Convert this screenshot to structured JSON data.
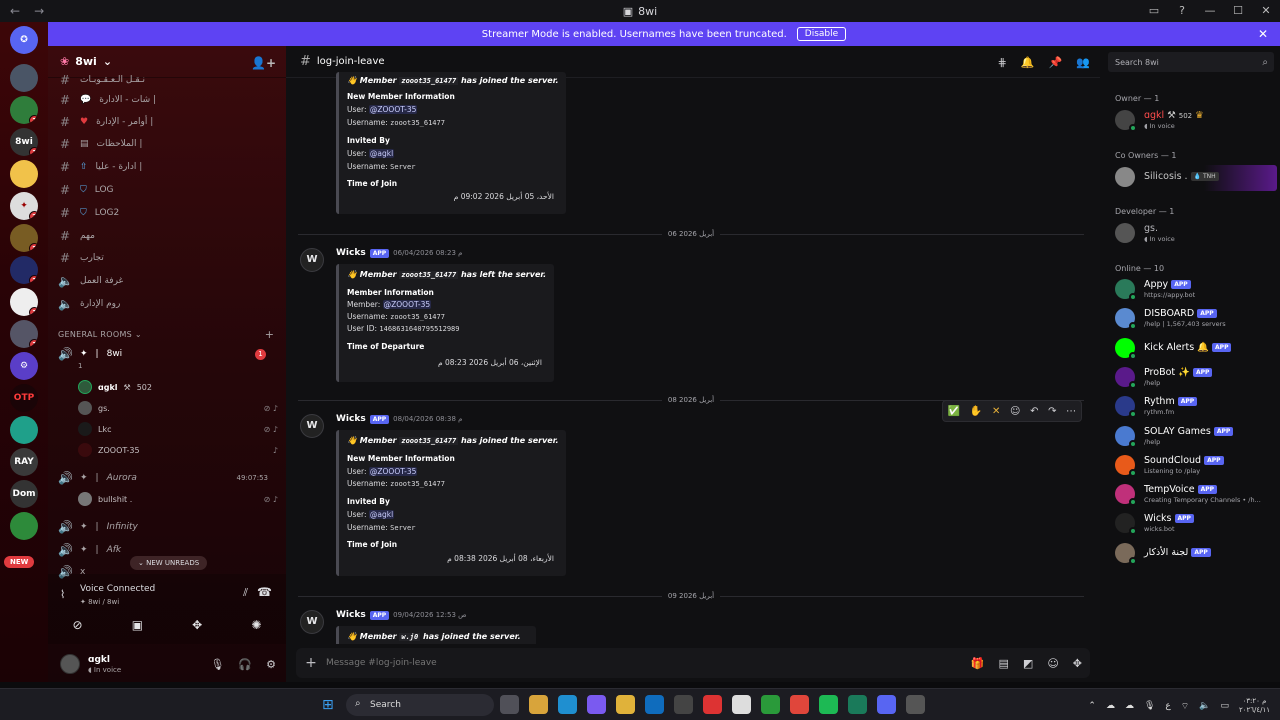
{
  "window": {
    "title": "8wi"
  },
  "banner": {
    "text": "Streamer Mode is enabled. Usernames have been truncated.",
    "button": "Disable"
  },
  "server": {
    "name": "8wi"
  },
  "channels": [
    {
      "name": "نـقـل الـعـقـوبـات",
      "icon": "#"
    },
    {
      "name": "شات - الادارة |",
      "icon": "#"
    },
    {
      "name": "أوامر - الإدارة |",
      "icon": "#"
    },
    {
      "name": "الملاحظات |",
      "icon": "#"
    },
    {
      "name": "ادارة - عليا |",
      "icon": "#"
    },
    {
      "name": "LOG",
      "icon": "#"
    },
    {
      "name": "LOG2",
      "icon": "#"
    },
    {
      "name": "مهم",
      "icon": "#"
    },
    {
      "name": "تجارب",
      "icon": "#"
    },
    {
      "name": "غرفة العمل",
      "icon": "speaker"
    },
    {
      "name": "روم الإدارة",
      "icon": "speaker"
    }
  ],
  "category": {
    "label": "GENERAL ROOMS"
  },
  "voice": {
    "room1": {
      "name": "8wi",
      "badge": "1",
      "sub": "1"
    },
    "users": [
      {
        "name": "ɑgkl",
        "tag": "502"
      },
      {
        "name": "gs."
      },
      {
        "name": "Lkc"
      },
      {
        "name": "ZOOOT-35"
      }
    ],
    "room2": {
      "name": "Aurora",
      "time": "49:07:53"
    },
    "room2_users": [
      {
        "name": "bullshit ."
      }
    ],
    "room3": {
      "name": "Infinity"
    },
    "room4": {
      "name": "Afk"
    },
    "room5": {
      "name": "x"
    },
    "new_unreads": "NEW UNREADS",
    "connected": "Voice Connected",
    "connected_sub": "8wi / 8wi"
  },
  "rail": {
    "new_label": "NEW",
    "labels": [
      "OTP",
      "RAY",
      "Dom"
    ]
  },
  "user": {
    "name": "ɑgkl",
    "status": "In voice"
  },
  "channel": {
    "name": "log-join-leave"
  },
  "dividers": [
    "06 أبريل 2026",
    "08 أبريل 2026",
    "09 أبريل 2026"
  ],
  "messages": [
    {
      "embed_title_pre": "Member",
      "embed_code": "zooot35_61477",
      "embed_title_post": "has joined the server.",
      "lab1": "New Member Information",
      "user_label": "User:",
      "user_mention": "@ZOOOT-35",
      "uname_label": "Username:",
      "uname": "zooot35_61477",
      "lab2": "Invited By",
      "inv_user": "@agkl",
      "inv_uname": "Server",
      "lab3": "Time of Join",
      "date": "الأحد، 05 أبريل 2026 09:02 م"
    },
    {
      "author": "Wicks",
      "badge": "APP",
      "time": "06/04/2026 08:23 م",
      "embed_title_pre": "Member",
      "embed_code": "zooot35_61477",
      "embed_title_post": "has left the server.",
      "lab1": "Member Information",
      "member_label": "Member:",
      "member_mention": "@ZOOOT-35",
      "uname_label": "Username:",
      "uname": "zooot35_61477",
      "uid_label": "User ID:",
      "uid": "1468631640795512989",
      "lab3": "Time of Departure",
      "date": "الإثنين، 06 أبريل 2026 08:23 م"
    },
    {
      "author": "Wicks",
      "badge": "APP",
      "time": "08/04/2026 08:38 م",
      "embed_title_pre": "Member",
      "embed_code": "zooot35_61477",
      "embed_title_post": "has joined the server.",
      "lab1": "New Member Information",
      "user_label": "User:",
      "user_mention": "@ZOOOT-35",
      "uname_label": "Username:",
      "uname": "zooot35_61477",
      "lab2": "Invited By",
      "inv_user": "@agkl",
      "inv_uname": "Server",
      "lab3": "Time of Join",
      "date": "الأربعاء، 08 أبريل 2026 08:38 م"
    },
    {
      "author": "Wicks",
      "badge": "APP",
      "time": "09/04/2026 12:53 ص",
      "embed_title_pre": "Member",
      "embed_code": "w.j0",
      "embed_title_post": "has joined the server."
    }
  ],
  "composer": {
    "placeholder": "Message #log-join-leave"
  },
  "members": {
    "search": "Search 8wi",
    "owner_group": "Owner — 1",
    "owner": {
      "name": "ɑgkl",
      "tag": "502",
      "status": "In voice"
    },
    "coowner_group": "Co Owners — 1",
    "coowner": {
      "name": "Silicosis .",
      "tag": "TNH"
    },
    "dev_group": "Developer — 1",
    "dev": {
      "name": "gs.",
      "status": "In voice"
    },
    "online_group": "Online — 10",
    "online": [
      {
        "name": "Appy",
        "badge": "APP",
        "status": "https://appy.bot",
        "color": "#ffffff"
      },
      {
        "name": "DISBOARD",
        "badge": "APP",
        "status": "/help | 1,567,403 servers",
        "color": "#ffffff"
      },
      {
        "name": "Kick Alerts 🔔",
        "badge": "APP",
        "status": "",
        "color": "#ffffff"
      },
      {
        "name": "ProBot ✨",
        "badge": "APP",
        "status": "/help",
        "color": "#ffffff"
      },
      {
        "name": "Rythm",
        "badge": "APP",
        "status": "rythm.fm",
        "color": "#ffffff"
      },
      {
        "name": "SOLAY Games",
        "badge": "APP",
        "status": "/help",
        "color": "#ffffff"
      },
      {
        "name": "SoundCloud",
        "badge": "APP",
        "status": "Listening to /play",
        "color": "#ffffff"
      },
      {
        "name": "TempVoice",
        "badge": "APP",
        "status": "Creating Temporary Channels • /h...",
        "color": "#ffffff"
      },
      {
        "name": "Wicks",
        "badge": "APP",
        "status": "wicks.bot",
        "color": "#ffffff"
      },
      {
        "name": "لجنة الأذكار",
        "badge": "APP",
        "status": "",
        "color": "#ffffff"
      }
    ]
  },
  "taskbar": {
    "search": "Search",
    "lang": "ع",
    "clock_time": "م ٠٣:٢٠",
    "clock_date": "٢٠٢٦/٤/١١"
  }
}
